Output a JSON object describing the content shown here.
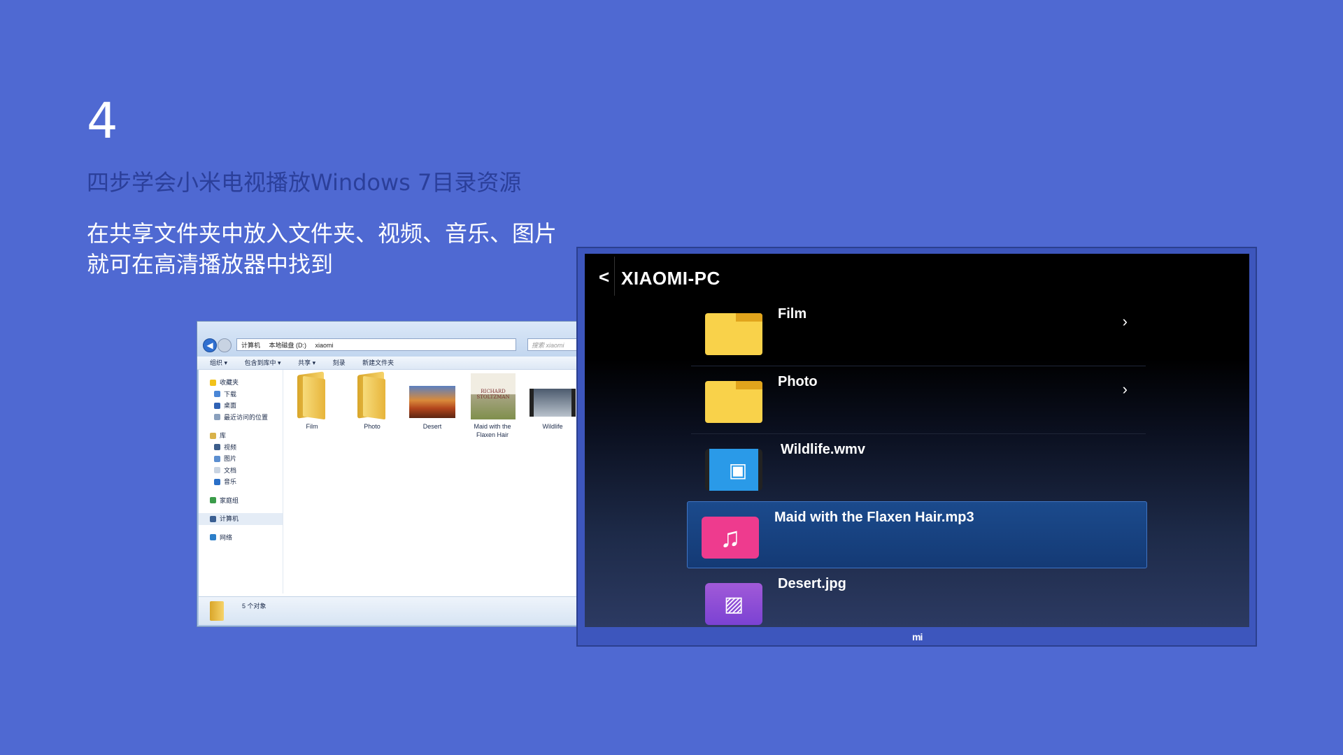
{
  "slide": {
    "step": "4",
    "subtitle": "四步学会小米电视播放Windows 7目录资源",
    "desc_line1": "在共享文件夹中放入文件夹、视频、音乐、图片",
    "desc_line2": "就可在高清播放器中找到"
  },
  "explorer": {
    "breadcrumb": [
      "计算机",
      "本地磁盘 (D:)",
      "xiaomi"
    ],
    "search_placeholder": "搜索 xiaomi",
    "toolbar": [
      "组织 ▾",
      "包含到库中 ▾",
      "共享 ▾",
      "刻录",
      "新建文件夹"
    ],
    "sidebar": {
      "favorites": "收藏夹",
      "favorites_items": [
        "下载",
        "桌面",
        "最近访问的位置"
      ],
      "library": "库",
      "library_items": [
        "视频",
        "图片",
        "文档",
        "音乐"
      ],
      "homegroup": "家庭组",
      "computer": "计算机",
      "network": "网络"
    },
    "files": [
      {
        "name": "Film",
        "type": "folder"
      },
      {
        "name": "Photo",
        "type": "folder"
      },
      {
        "name": "Desert",
        "type": "image"
      },
      {
        "name": "Maid with the Flaxen Hair",
        "type": "music"
      },
      {
        "name": "Wildlife",
        "type": "video"
      }
    ],
    "book_text": "RICHARD STOLTZMAN",
    "status": "5 个对象"
  },
  "tv": {
    "title": "XIAOMI-PC",
    "brand": "mi",
    "items": [
      {
        "label": "Film",
        "icon": "folder-icon",
        "has_chevron": true
      },
      {
        "label": "Photo",
        "icon": "folder-icon",
        "has_chevron": true
      },
      {
        "label": "Wildlife.wmv",
        "icon": "video-icon",
        "has_chevron": false
      },
      {
        "label": "Maid with the Flaxen Hair.mp3",
        "icon": "music-icon",
        "has_chevron": false,
        "selected": true
      },
      {
        "label": "Desert.jpg",
        "icon": "image-icon",
        "has_chevron": false
      }
    ],
    "colors": {
      "folder": "#f9d24a",
      "video": "#2a9ae8",
      "music": "#ee3b8e",
      "image": "#8b4cd6",
      "selected": "#1b4a8c"
    }
  }
}
